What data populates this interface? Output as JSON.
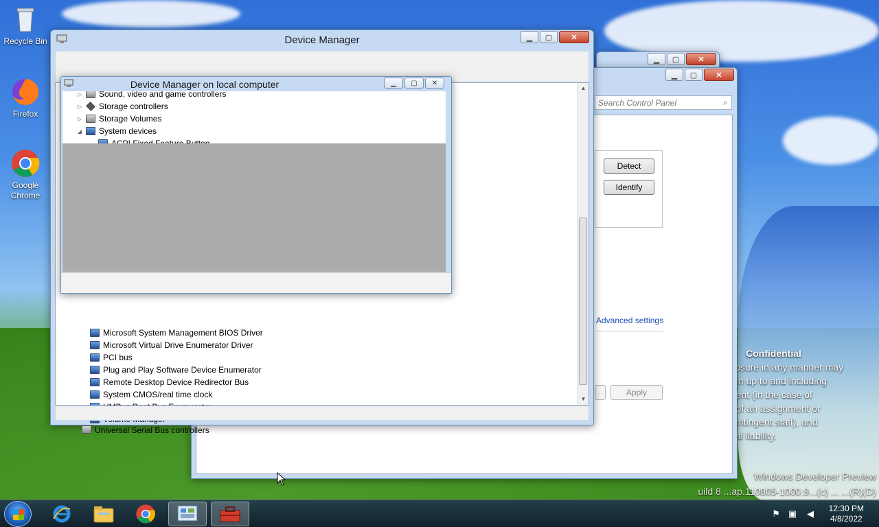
{
  "desktop": {
    "icons": [
      {
        "label": "Recycle Bin",
        "icon": "recycle-bin-icon"
      },
      {
        "label": "Firefox",
        "icon": "firefox-icon"
      },
      {
        "label": "Google Chrome",
        "icon": "chrome-icon"
      }
    ],
    "confidential": {
      "heading": "Confidential",
      "lines": [
        "closure in any manner may",
        "tion up to and including",
        "ment (in the case of",
        "n of an assignment or",
        "contingent staff), and",
        "inal liability."
      ]
    },
    "watermark": [
      "Windows Developer Preview",
      "uild 8 ...ap.110805-1000.9...(c) ... ...(R)(D)"
    ]
  },
  "control_panel": {
    "search_placeholder": "Search Control Panel",
    "detect_label": "Detect",
    "identify_label": "Identify",
    "advanced_settings": "Advanced settings",
    "apply_label": "Apply"
  },
  "device_manager": {
    "title": "Device Manager",
    "child_title": "Device Manager on local computer",
    "tree_top": [
      {
        "label": "Sound, video and game controllers",
        "level": 0,
        "exp": "▷",
        "icon": "sound-icon"
      },
      {
        "label": "Storage controllers",
        "level": 0,
        "exp": "▷",
        "icon": "storage-controller-icon"
      },
      {
        "label": "Storage Volumes",
        "level": 0,
        "exp": "▷",
        "icon": "storage-volume-icon"
      },
      {
        "label": "System devices",
        "level": 0,
        "exp": "◢",
        "icon": "system-devices-icon"
      },
      {
        "label": "ACPI Fixed Feature Button",
        "level": 1,
        "exp": "",
        "icon": "device-icon"
      }
    ],
    "tree_bottom": [
      {
        "label": "Microsoft System Management BIOS Driver",
        "level": 1
      },
      {
        "label": "Microsoft Virtual Drive Enumerator Driver",
        "level": 1
      },
      {
        "label": "PCI bus",
        "level": 1
      },
      {
        "label": "Plug and Play Software Device Enumerator",
        "level": 1
      },
      {
        "label": "Remote Desktop Device Redirector Bus",
        "level": 1
      },
      {
        "label": "System CMOS/real time clock",
        "level": 1
      },
      {
        "label": "UMBus Root Bus Enumerator",
        "level": 1
      },
      {
        "label": "Volume Manager",
        "level": 1
      },
      {
        "label": "Universal Serial Bus controllers",
        "level": 0
      }
    ]
  },
  "taskbar": {
    "apps": [
      "internet-explorer-icon",
      "file-explorer-icon",
      "chrome-icon",
      "control-panel-icon",
      "device-manager-icon"
    ],
    "time": "12:30 PM",
    "date": "4/8/2022"
  }
}
